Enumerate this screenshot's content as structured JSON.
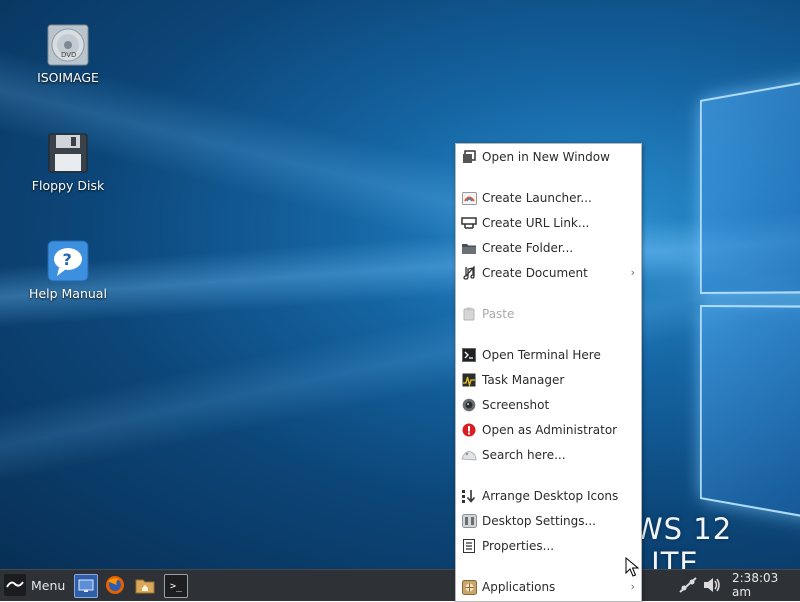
{
  "desktop": {
    "wordmark": "WS 12 LITE",
    "icons": [
      {
        "label": "ISOIMAGE",
        "icon": "dvd-disc-icon"
      },
      {
        "label": "Floppy Disk",
        "icon": "floppy-disk-icon"
      },
      {
        "label": "Help Manual",
        "icon": "help-question-icon"
      }
    ]
  },
  "context_menu": {
    "items": [
      {
        "label": "Open in New Window",
        "icon": "new-window-icon",
        "enabled": true
      },
      {
        "label": "Create Launcher...",
        "icon": "launcher-icon",
        "enabled": true
      },
      {
        "label": "Create URL Link...",
        "icon": "url-link-icon",
        "enabled": true
      },
      {
        "label": "Create Folder...",
        "icon": "folder-icon",
        "enabled": true
      },
      {
        "label": "Create Document",
        "icon": "document-icon",
        "enabled": true,
        "submenu": "›"
      },
      {
        "label": "Paste",
        "icon": "clipboard-icon",
        "enabled": false
      },
      {
        "label": "Open Terminal Here",
        "icon": "terminal-icon",
        "enabled": true
      },
      {
        "label": "Task Manager",
        "icon": "task-manager-icon",
        "enabled": true
      },
      {
        "label": "Screenshot",
        "icon": "camera-icon",
        "enabled": true
      },
      {
        "label": "Open as Administrator",
        "icon": "warning-icon",
        "enabled": true
      },
      {
        "label": "Search here...",
        "icon": "search-icon",
        "enabled": true
      },
      {
        "label": "Arrange Desktop Icons",
        "icon": "arrange-icon",
        "enabled": true
      },
      {
        "label": "Desktop Settings...",
        "icon": "settings-icon",
        "enabled": true
      },
      {
        "label": "Properties...",
        "icon": "properties-icon",
        "enabled": true
      },
      {
        "label": "Applications",
        "icon": "applications-icon",
        "enabled": true,
        "submenu": "›"
      }
    ]
  },
  "taskbar": {
    "menu_label": "Menu",
    "launchers": [
      "desktop-icon",
      "firefox-icon",
      "home-folder-icon",
      "terminal-icon"
    ],
    "tray": [
      "network-icon",
      "volume-icon"
    ],
    "clock": "2:38:03 am"
  },
  "colors": {
    "desktop_blue": "#1565a3",
    "taskbar_bg": "#2e3236",
    "menu_bg": "#ffffff",
    "disabled_text": "#a9a9a9"
  }
}
